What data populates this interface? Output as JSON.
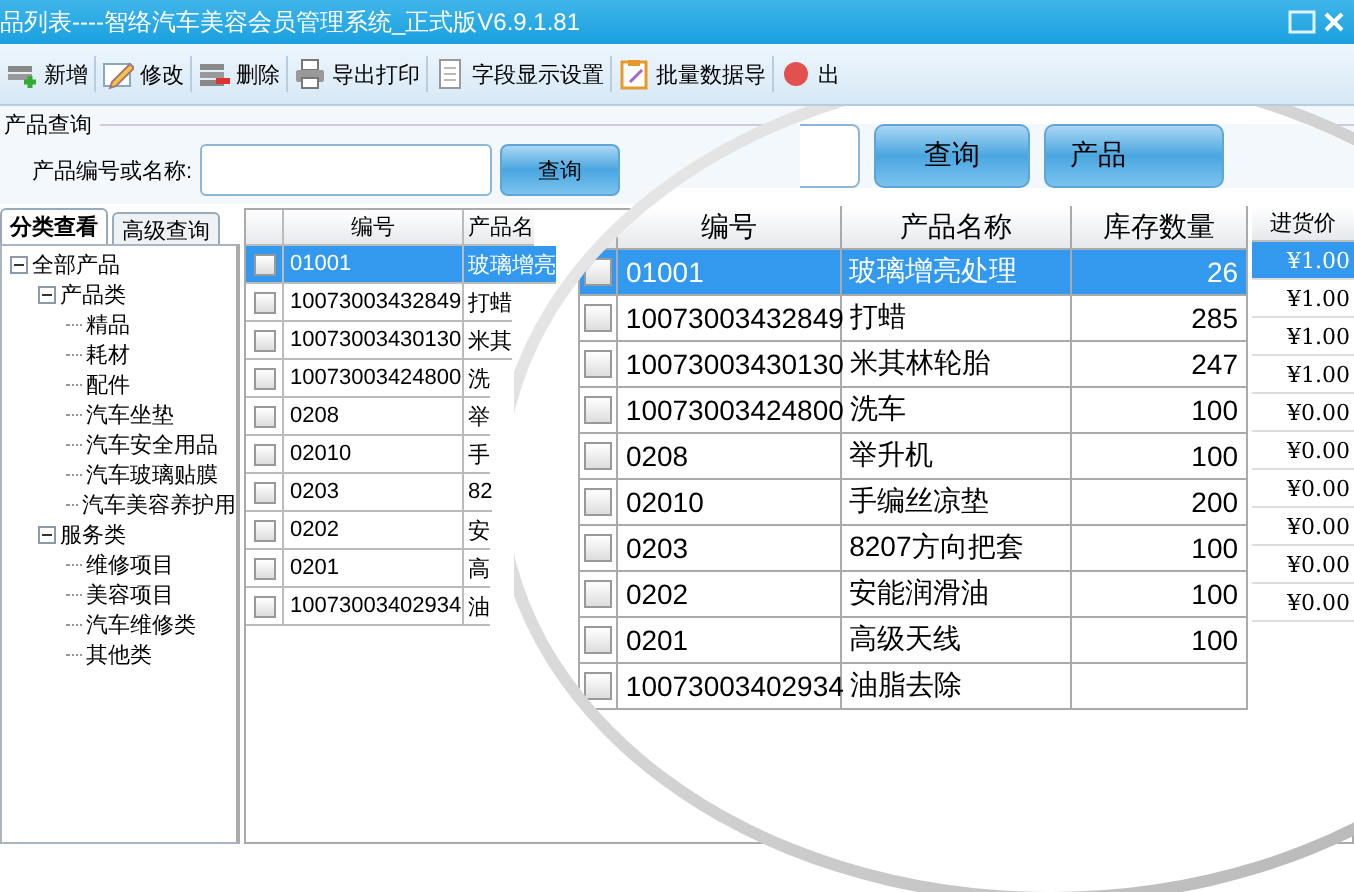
{
  "window": {
    "title": "品列表----智络汽车美容会员管理系统_正式版V6.9.1.81"
  },
  "toolbar": {
    "buttons": [
      {
        "label": "新增"
      },
      {
        "label": "修改"
      },
      {
        "label": "删除"
      },
      {
        "label": "导出打印"
      },
      {
        "label": "字段显示设置"
      },
      {
        "label": "批量数据导"
      },
      {
        "label": "出"
      }
    ]
  },
  "search": {
    "title": "产品查询",
    "label": "产品编号或名称:",
    "button": "查询"
  },
  "tabs": [
    {
      "label": "分类查看",
      "selected": true
    },
    {
      "label": "高级查询",
      "selected": false
    }
  ],
  "tree": [
    {
      "label": "全部产品",
      "expanded": true,
      "children": [
        {
          "label": "产品类",
          "expanded": true,
          "children": [
            {
              "label": "精品"
            },
            {
              "label": "耗材"
            },
            {
              "label": "配件"
            },
            {
              "label": "汽车坐垫"
            },
            {
              "label": "汽车安全用品"
            },
            {
              "label": "汽车玻璃贴膜"
            },
            {
              "label": "汽车美容养护用"
            }
          ]
        },
        {
          "label": "服务类",
          "expanded": true,
          "children": [
            {
              "label": "维修项目"
            },
            {
              "label": "美容项目"
            },
            {
              "label": "汽车维修类"
            },
            {
              "label": "其他类"
            }
          ]
        }
      ]
    }
  ],
  "table": {
    "columns": [
      "编号",
      "产品名"
    ],
    "rows": [
      {
        "code": "01001",
        "name": "玻璃增亮",
        "checked": false,
        "selected": true
      },
      {
        "code": "10073003432849",
        "name": "打蜡",
        "checked": false,
        "selected": false
      },
      {
        "code": "10073003430130",
        "name": "米其",
        "checked": false,
        "selected": false
      },
      {
        "code": "10073003424800",
        "name": "洗",
        "checked": false,
        "selected": false
      },
      {
        "code": "0208",
        "name": "举",
        "checked": false,
        "selected": false
      },
      {
        "code": "02010",
        "name": "手",
        "checked": false,
        "selected": false
      },
      {
        "code": "0203",
        "name": "82",
        "checked": false,
        "selected": false
      },
      {
        "code": "0202",
        "name": "安",
        "checked": false,
        "selected": false
      },
      {
        "code": "0201",
        "name": "高",
        "checked": false,
        "selected": false
      },
      {
        "code": "10073003402934",
        "name": "油",
        "checked": false,
        "selected": false
      }
    ]
  },
  "magnifier": {
    "buttons": [
      "查询",
      "产品"
    ],
    "columns": [
      "编号",
      "产品名称",
      "库存数量"
    ],
    "price_column": "进货价",
    "rows": [
      {
        "code": "01001",
        "name": "玻璃增亮处理",
        "stock": "26",
        "price": "¥1.00",
        "checked": false,
        "selected": true
      },
      {
        "code": "10073003432849",
        "name": "打蜡",
        "stock": "285",
        "price": "¥1.00",
        "checked": false,
        "selected": false
      },
      {
        "code": "10073003430130",
        "name": "米其林轮胎",
        "stock": "247",
        "price": "¥1.00",
        "checked": false,
        "selected": false
      },
      {
        "code": "10073003424800",
        "name": "洗车",
        "stock": "100",
        "price": "¥1.00",
        "checked": false,
        "selected": false
      },
      {
        "code": "0208",
        "name": "举升机",
        "stock": "100",
        "price": "¥0.00",
        "checked": false,
        "selected": false
      },
      {
        "code": "02010",
        "name": "手编丝凉垫",
        "stock": "200",
        "price": "¥0.00",
        "checked": false,
        "selected": false
      },
      {
        "code": "0203",
        "name": "8207方向把套",
        "stock": "100",
        "price": "¥0.00",
        "checked": false,
        "selected": false
      },
      {
        "code": "0202",
        "name": "安能润滑油",
        "stock": "100",
        "price": "¥0.00",
        "checked": false,
        "selected": false
      },
      {
        "code": "0201",
        "name": "高级天线",
        "stock": "100",
        "price": "¥0.00",
        "checked": false,
        "selected": false
      },
      {
        "code": "10073003402934",
        "name": "油脂去除",
        "price": "¥0.00",
        "checked": false,
        "selected": false
      }
    ]
  }
}
